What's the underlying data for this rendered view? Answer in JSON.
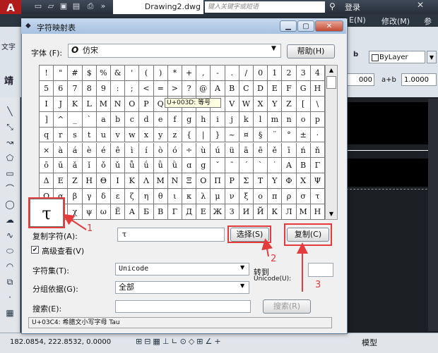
{
  "cad": {
    "logo": "A",
    "file_tab": "Drawing2.dwg",
    "search_placeholder": "键入关键字或短语",
    "login": "登录",
    "menu_items": [
      "E(N)",
      "修改(M)",
      "参数"
    ],
    "ribbon_left": "文字",
    "ribbon_left2": "靖",
    "bylayer": "ByLayer",
    "scale_value": "1.0000",
    "value_000": "000",
    "coords": "182.0854, 222.8532, 0.0000",
    "model_label": "模型"
  },
  "dialog": {
    "title": "字符映射表",
    "font_label": "字体 (F):",
    "font_value": "仿宋",
    "help_button": "帮助(H)",
    "tooltip": "U+003D: 等号",
    "big_char": "τ",
    "copy_label": "复制字符(A):",
    "copy_value": "τ",
    "select_button": "选择(S)",
    "copy_button": "复制(C)",
    "advanced_label": "高级查看(V)",
    "advanced_checked": true,
    "charset_label": "字符集(T):",
    "charset_value": "Unicode",
    "goto_label": "转到",
    "goto_label2": "Unicode(U):",
    "group_label": "分组依据(G):",
    "group_value": "全部",
    "search_label": "搜索(E):",
    "search_button": "搜索(R)",
    "status_line": "U+03C4: 希腊文小写字母 Tau"
  },
  "grid_rows": [
    [
      "!",
      "\"",
      "#",
      "$",
      "%",
      "&",
      "'",
      "(",
      ")",
      "*",
      "+",
      ",",
      "-",
      ".",
      "/",
      "0",
      "1",
      "2",
      "3",
      "4"
    ],
    [
      "5",
      "6",
      "7",
      "8",
      "9",
      ":",
      ";",
      "<",
      "=",
      ">",
      "?",
      "@",
      "A",
      "B",
      "C",
      "D",
      "E",
      "F",
      "G",
      "H"
    ],
    [
      "I",
      "J",
      "K",
      "L",
      "M",
      "N",
      "O",
      "P",
      "Q",
      "R",
      "S",
      "T",
      "U",
      "V",
      "W",
      "X",
      "Y",
      "Z",
      "[",
      "\\"
    ],
    [
      "]",
      "^",
      "_",
      "`",
      "a",
      "b",
      "c",
      "d",
      "e",
      "f",
      "g",
      "h",
      "i",
      "j",
      "k",
      "l",
      "m",
      "n",
      "o",
      "p"
    ],
    [
      "q",
      "r",
      "s",
      "t",
      "u",
      "v",
      "w",
      "x",
      "y",
      "z",
      "{",
      "|",
      "}",
      "~",
      "¤",
      "§",
      "¨",
      "°",
      "±",
      "·"
    ],
    [
      "×",
      "à",
      "á",
      "è",
      "é",
      "ê",
      "ì",
      "í",
      "ò",
      "ó",
      "÷",
      "ù",
      "ú",
      "ü",
      "ā",
      "ē",
      "ě",
      "ī",
      "ń",
      "ň"
    ],
    [
      "ō",
      "ū",
      "ǎ",
      "ǐ",
      "ǒ",
      "ǔ",
      "ǖ",
      "ǘ",
      "ǚ",
      "ǜ",
      "ɑ",
      "ɡ",
      "ˇ",
      "ˉ",
      "ˊ",
      "ˋ",
      "˙",
      "Α",
      "Β",
      "Γ"
    ],
    [
      "Δ",
      "Ε",
      "Ζ",
      "Η",
      "Θ",
      "Ι",
      "Κ",
      "Λ",
      "Μ",
      "Ν",
      "Ξ",
      "Ο",
      "Π",
      "Ρ",
      "Σ",
      "Τ",
      "Υ",
      "Φ",
      "Χ",
      "Ψ"
    ],
    [
      "Ω",
      "α",
      "β",
      "γ",
      "δ",
      "ε",
      "ζ",
      "η",
      "θ",
      "ι",
      "κ",
      "λ",
      "μ",
      "ν",
      "ξ",
      "ο",
      "π",
      "ρ",
      "σ",
      "τ"
    ],
    [
      "υ",
      "φ",
      "χ",
      "ψ",
      "ω",
      "Ё",
      "А",
      "Б",
      "В",
      "Г",
      "Д",
      "Е",
      "Ж",
      "З",
      "И",
      "Й",
      "К",
      "Л",
      "М",
      "Н"
    ]
  ],
  "annotations": {
    "n1": "1",
    "n2": "2",
    "n3": "3"
  },
  "colors": {
    "annotation": "#e43c3c",
    "title_bar": "#a6c1e0"
  }
}
